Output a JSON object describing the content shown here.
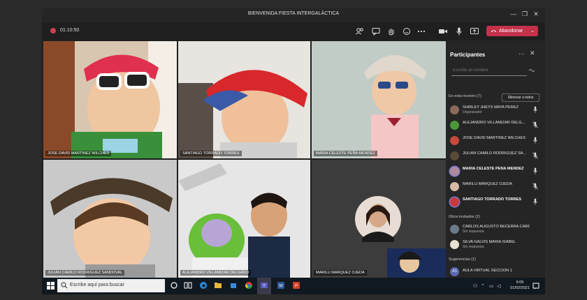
{
  "window": {
    "title": "BIENVENIDA FIESTA INTERGALÁCTICA",
    "minimize": "—",
    "maximize": "❐",
    "close": "✕"
  },
  "toolbar": {
    "recording_time": "01:10:50",
    "leave_label": "Abandonar",
    "leave_color": "#c4314b",
    "icons": [
      "participants-icon",
      "chat-icon",
      "raise-hand-icon",
      "reactions-icon",
      "more-icon",
      "camera-icon",
      "mic-icon",
      "share-icon"
    ]
  },
  "video_tiles": [
    {
      "name": "JOSE DAVID MARTINEZ WILCHES"
    },
    {
      "name": "SANTIAGO TORRADO TORRES"
    },
    {
      "name": "MARIA CELESTE PEÑA MENDEZ"
    },
    {
      "name": "JULIAN CAMILO RODRIGUEZ SANDOVAL"
    },
    {
      "name": "ALEJANDRO VILLAMIZAR DELGADO"
    },
    {
      "name": "MARILU MARQUEZ OJEDA"
    }
  ],
  "panel": {
    "title": "Participantes",
    "search_placeholder": "Escribe un nombre",
    "in_meeting_header": "En esta reunión (7)",
    "mute_all": "Silenciar a todos",
    "participants": [
      {
        "name": "SHIRLEY JHEYS MAYA PEREZ",
        "role": "Organizador",
        "bold": false
      },
      {
        "name": "ALEJANDRO VILLAMIZAR DELG...",
        "bold": false
      },
      {
        "name": "JOSE DAVID MARTINEZ WILCHES",
        "bold": false
      },
      {
        "name": "JULIAN CAMILO RODRIGUEZ SA...",
        "bold": false
      },
      {
        "name": "MARIA CELESTE PEÑA MENDEZ",
        "bold": true
      },
      {
        "name": "MARILU MARQUEZ OJEDA",
        "bold": false
      },
      {
        "name": "SANTIAGO TORRADO TORRES",
        "bold": true
      }
    ],
    "others_header": "Otros invitados (2)",
    "others": [
      {
        "name": "CARLOS AUGUSTO BECERRA CARDE...",
        "status": "Sin respuesta"
      },
      {
        "name": "SILVA GALVIS MARIA ISABEL",
        "status": "Sin respuesta"
      }
    ],
    "suggestions_header": "Sugerencias (1)",
    "suggestions": [
      {
        "name": "AULA VIRTUAL SECCION 1",
        "initials": "AS"
      }
    ]
  },
  "taskbar": {
    "search_placeholder": "Escribe aquí para buscar",
    "time": "9:09",
    "date": "01/02/2021"
  }
}
